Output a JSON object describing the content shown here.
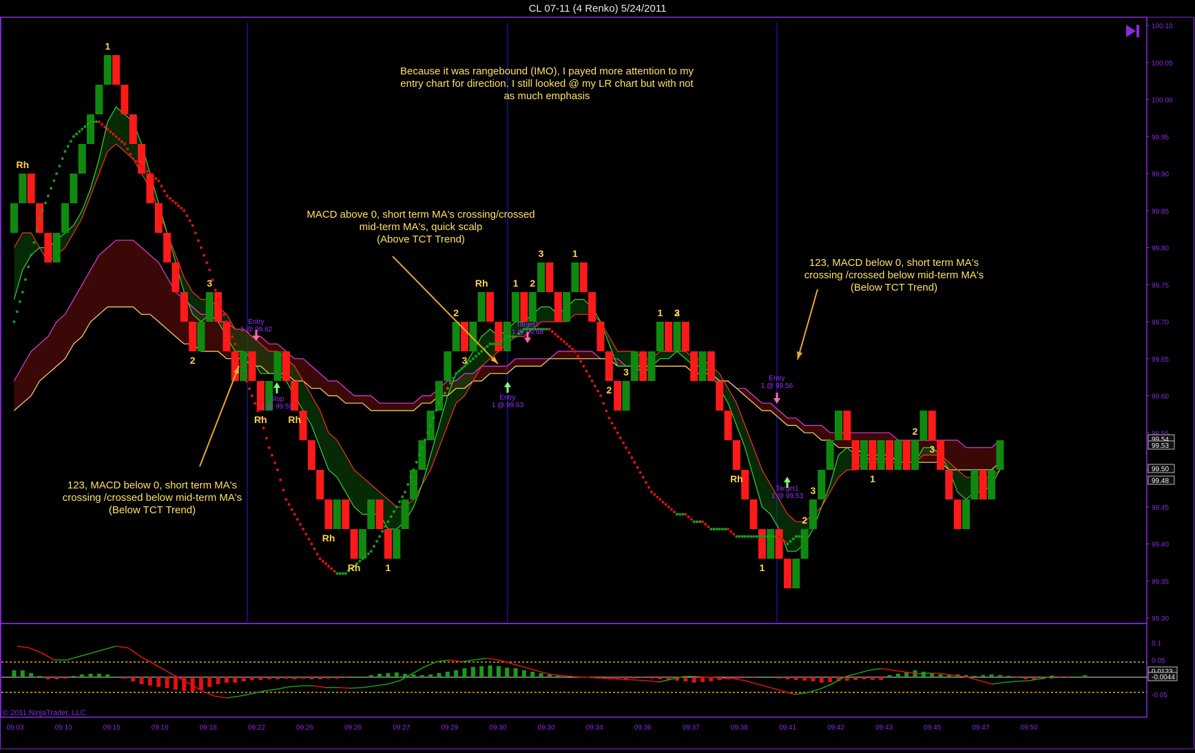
{
  "window": {
    "title": "CL 07-11 (4 Renko)  5/24/2011"
  },
  "copyright": "© 2011 NinjaTrader, LLC",
  "colors": {
    "background": "#000000",
    "frame": "#8a2be2",
    "axis_text": "#8a2be2",
    "bull_bar": "#0f8a0f",
    "bear_bar": "#ff1a1a",
    "annotation_text": "#ffe066",
    "pattern_label": "#ffd34d",
    "session_line": "#1c1cbf"
  },
  "chart_data": [
    {
      "type": "renko",
      "panel": "price",
      "instrument": "CL 07-11",
      "brick_size": "4 Renko",
      "date": "5/24/2011",
      "ylim": [
        99.3,
        100.1
      ],
      "y_ticks": [
        "100.10",
        "100.05",
        "100.00",
        "99.95",
        "99.90",
        "99.85",
        "99.80",
        "99.75",
        "99.70",
        "99.65",
        "99.60",
        "99.55",
        "99.50",
        "99.45",
        "99.40",
        "99.35",
        "99.30"
      ],
      "x_ticks": [
        "09:03",
        "09:10",
        "09:15",
        "09:16",
        "09:18",
        "09:22",
        "09:26",
        "09:26",
        "09:27",
        "09:29",
        "09:30",
        "09:30",
        "09:34",
        "09:36",
        "09:37",
        "09:38",
        "09:41",
        "09:42",
        "09:43",
        "09:45",
        "09:47",
        "09:50"
      ],
      "brick_closes": [
        99.86,
        99.9,
        99.86,
        99.82,
        99.78,
        99.82,
        99.86,
        99.9,
        99.94,
        99.98,
        100.02,
        100.06,
        100.02,
        99.98,
        99.94,
        99.9,
        99.86,
        99.82,
        99.78,
        99.74,
        99.7,
        99.66,
        99.7,
        99.74,
        99.7,
        99.66,
        99.62,
        99.66,
        99.62,
        99.58,
        99.62,
        99.66,
        99.62,
        99.58,
        99.54,
        99.5,
        99.46,
        99.42,
        99.46,
        99.42,
        99.38,
        99.42,
        99.46,
        99.42,
        99.38,
        99.42,
        99.46,
        99.5,
        99.54,
        99.58,
        99.62,
        99.66,
        99.7,
        99.66,
        99.7,
        99.74,
        99.7,
        99.66,
        99.7,
        99.74,
        99.7,
        99.74,
        99.78,
        99.74,
        99.7,
        99.74,
        99.78,
        99.74,
        99.7,
        99.66,
        99.62,
        99.58,
        99.62,
        99.66,
        99.62,
        99.66,
        99.7,
        99.66,
        99.7,
        99.66,
        99.62,
        99.66,
        99.62,
        99.58,
        99.54,
        99.5,
        99.46,
        99.42,
        99.38,
        99.42,
        99.38,
        99.34,
        99.38,
        99.42,
        99.46,
        99.5,
        99.54,
        99.58,
        99.54,
        99.5,
        99.54,
        99.5,
        99.54,
        99.5,
        99.54,
        99.5,
        99.54,
        99.58,
        99.54,
        99.5,
        99.46,
        99.42,
        99.46,
        99.5,
        99.46,
        99.5,
        99.54
      ],
      "current_price_tags": [
        "99.54",
        "99.53",
        "99.50",
        "99.48"
      ],
      "fast_ma": [
        99.73,
        99.77,
        99.79,
        99.8,
        99.8,
        99.81,
        99.82,
        99.83,
        99.85,
        99.88,
        99.92,
        99.97,
        99.99,
        99.98,
        99.97,
        99.94,
        99.9,
        99.86,
        99.82,
        99.78,
        99.74,
        99.71,
        99.7,
        99.71,
        99.7,
        99.68,
        99.66,
        99.66,
        99.65,
        99.63,
        99.63,
        99.63,
        99.62,
        99.6,
        99.58,
        99.56,
        99.53,
        99.5,
        99.49,
        99.47,
        99.45,
        99.44,
        99.44,
        99.44,
        99.42,
        99.42,
        99.43,
        99.45,
        99.48,
        99.52,
        99.56,
        99.6,
        99.63,
        99.64,
        99.66,
        99.68,
        99.69,
        99.68,
        99.69,
        99.7,
        99.7,
        99.71,
        99.72,
        99.72,
        99.71,
        99.72,
        99.73,
        99.73,
        99.72,
        99.7,
        99.67,
        99.64,
        99.64,
        99.64,
        99.63,
        99.64,
        99.65,
        99.65,
        99.66,
        99.65,
        99.64,
        99.64,
        99.63,
        99.61,
        99.59,
        99.56,
        99.53,
        99.49,
        99.45,
        99.44,
        99.42,
        99.39,
        99.39,
        99.4,
        99.42,
        99.45,
        99.48,
        99.52,
        99.53,
        99.52,
        99.52,
        99.51,
        99.52,
        99.51,
        99.51,
        99.51,
        99.51,
        99.53,
        99.53,
        99.52,
        99.5,
        99.47,
        99.46,
        99.47,
        99.47,
        99.48,
        99.5
      ],
      "medium_ma": [
        99.8,
        99.82,
        99.82,
        99.8,
        99.78,
        99.79,
        99.8,
        99.82,
        99.84,
        99.87,
        99.9,
        99.93,
        99.94,
        99.93,
        99.92,
        99.9,
        99.88,
        99.85,
        99.82,
        99.79,
        99.76,
        99.74,
        99.73,
        99.73,
        99.72,
        99.71,
        99.69,
        99.69,
        99.68,
        99.67,
        99.66,
        99.66,
        99.65,
        99.64,
        99.62,
        99.6,
        99.58,
        99.55,
        99.54,
        99.52,
        99.5,
        99.49,
        99.48,
        99.47,
        99.46,
        99.45,
        99.45,
        99.46,
        99.48,
        99.5,
        99.53,
        99.56,
        99.59,
        99.6,
        99.62,
        99.64,
        99.65,
        99.66,
        99.67,
        99.68,
        99.68,
        99.69,
        99.7,
        99.7,
        99.7,
        99.7,
        99.71,
        99.71,
        99.71,
        99.7,
        99.68,
        99.66,
        99.66,
        99.66,
        99.65,
        99.65,
        99.66,
        99.66,
        99.66,
        99.66,
        99.65,
        99.65,
        99.64,
        99.63,
        99.61,
        99.59,
        99.56,
        99.53,
        99.5,
        99.48,
        99.46,
        99.44,
        99.43,
        99.43,
        99.44,
        99.45,
        99.47,
        99.49,
        99.5,
        99.5,
        99.51,
        99.51,
        99.51,
        99.51,
        99.51,
        99.51,
        99.51,
        99.52,
        99.52,
        99.52,
        99.51,
        99.5,
        99.49,
        99.49,
        99.49,
        99.49,
        99.5
      ],
      "slow_ma_1": [
        99.62,
        99.64,
        99.66,
        99.67,
        99.68,
        99.7,
        99.71,
        99.73,
        99.75,
        99.77,
        99.79,
        99.8,
        99.81,
        99.81,
        99.81,
        99.8,
        99.79,
        99.78,
        99.76,
        99.74,
        99.73,
        99.72,
        99.71,
        99.71,
        99.7,
        99.7,
        99.69,
        99.69,
        99.68,
        99.68,
        99.67,
        99.67,
        99.66,
        99.65,
        99.65,
        99.64,
        99.63,
        99.62,
        99.62,
        99.61,
        99.6,
        99.6,
        99.6,
        99.59,
        99.59,
        99.59,
        99.59,
        99.59,
        99.6,
        99.6,
        99.61,
        99.62,
        99.62,
        99.63,
        99.63,
        99.64,
        99.64,
        99.64,
        99.64,
        99.65,
        99.65,
        99.65,
        99.65,
        99.65,
        99.66,
        99.66,
        99.66,
        99.66,
        99.66,
        99.65,
        99.65,
        99.65,
        99.64,
        99.64,
        99.64,
        99.64,
        99.64,
        99.64,
        99.64,
        99.64,
        99.63,
        99.63,
        99.63,
        99.62,
        99.62,
        99.61,
        99.61,
        99.6,
        99.59,
        99.59,
        99.58,
        99.57,
        99.57,
        99.56,
        99.56,
        99.56,
        99.55,
        99.55,
        99.55,
        99.55,
        99.55,
        99.55,
        99.55,
        99.55,
        99.54,
        99.54,
        99.54,
        99.54,
        99.54,
        99.54,
        99.54,
        99.54,
        99.53,
        99.53,
        99.53,
        99.53,
        99.54
      ],
      "slow_ma_2": [
        99.58,
        99.59,
        99.6,
        99.62,
        99.63,
        99.64,
        99.65,
        99.67,
        99.68,
        99.7,
        99.71,
        99.72,
        99.72,
        99.72,
        99.72,
        99.71,
        99.71,
        99.7,
        99.69,
        99.68,
        99.67,
        99.67,
        99.66,
        99.66,
        99.66,
        99.65,
        99.65,
        99.65,
        99.64,
        99.64,
        99.63,
        99.63,
        99.63,
        99.62,
        99.62,
        99.61,
        99.61,
        99.6,
        99.6,
        99.59,
        99.59,
        99.59,
        99.58,
        99.58,
        99.58,
        99.58,
        99.58,
        99.58,
        99.59,
        99.59,
        99.6,
        99.6,
        99.61,
        99.61,
        99.62,
        99.62,
        99.63,
        99.63,
        99.63,
        99.64,
        99.64,
        99.64,
        99.64,
        99.65,
        99.65,
        99.65,
        99.65,
        99.65,
        99.65,
        99.65,
        99.65,
        99.64,
        99.64,
        99.64,
        99.64,
        99.64,
        99.64,
        99.64,
        99.64,
        99.64,
        99.63,
        99.63,
        99.63,
        99.62,
        99.62,
        99.61,
        99.6,
        99.59,
        99.58,
        99.58,
        99.57,
        99.56,
        99.56,
        99.55,
        99.55,
        99.54,
        99.54,
        99.53,
        99.53,
        99.53,
        99.52,
        99.52,
        99.52,
        99.52,
        99.51,
        99.51,
        99.51,
        99.51,
        99.51,
        99.51,
        99.5,
        99.5,
        99.5,
        99.5,
        99.5,
        99.5,
        99.51
      ],
      "long_ma": [
        99.7,
        99.74,
        99.79,
        99.84,
        99.87,
        99.9,
        99.93,
        99.95,
        99.96,
        99.97,
        99.97,
        99.96,
        99.95,
        99.94,
        99.92,
        99.91,
        99.9,
        99.89,
        99.87,
        99.86,
        99.85,
        99.83,
        99.8,
        99.77,
        99.73,
        99.7,
        99.67,
        99.63,
        99.6,
        99.57,
        99.53,
        99.5,
        99.46,
        99.44,
        99.42,
        99.4,
        99.38,
        99.37,
        99.36,
        99.36,
        99.37,
        99.38,
        99.39,
        99.41,
        99.43,
        99.45,
        99.47,
        99.5,
        99.53,
        99.56,
        99.59,
        99.61,
        99.63,
        99.64,
        99.65,
        99.66,
        99.67,
        99.67,
        99.68,
        99.68,
        99.69,
        99.69,
        99.69,
        99.69,
        99.68,
        99.67,
        99.66,
        99.64,
        99.62,
        99.6,
        99.57,
        99.55,
        99.53,
        99.51,
        99.49,
        99.47,
        99.46,
        99.45,
        99.44,
        99.44,
        99.43,
        99.43,
        99.42,
        99.42,
        99.42,
        99.41,
        99.41,
        99.41,
        99.41,
        99.41,
        99.41,
        99.4,
        99.41,
        99.41
      ],
      "annotations": [
        {
          "text": "Because it was rangebound (IMO), I payed more attention to my\nentry chart for direction.  I still looked @ my LR chart but with not\nas much emphasis"
        },
        {
          "text": "MACD above 0, short term MA's crossing/crossed\nmid-term MA's, quick scalp\n(Above TCT Trend)"
        },
        {
          "text": "123, MACD below 0, short term MA's\ncrossing /crossed below mid-term MA's\n(Below TCT Trend)"
        },
        {
          "text": "123, MACD below 0, short term MA's\ncrossing /crossed below mid-term MA's\n(Below TCT Trend)"
        }
      ],
      "pattern_labels": [
        {
          "text": "1",
          "brick": 11
        },
        {
          "text": "Rh",
          "brick": 1
        },
        {
          "text": "3",
          "brick": 23
        },
        {
          "text": "2",
          "brick": 21
        },
        {
          "text": "Rh",
          "brick": 29
        },
        {
          "text": "Rh",
          "brick": 33
        },
        {
          "text": "Rh",
          "brick": 37
        },
        {
          "text": "Rh",
          "brick": 40
        },
        {
          "text": "1",
          "brick": 44
        },
        {
          "text": "2",
          "brick": 52
        },
        {
          "text": "3",
          "brick": 53
        },
        {
          "text": "Rh",
          "brick": 55
        },
        {
          "text": "1",
          "brick": 59
        },
        {
          "text": "3",
          "brick": 62
        },
        {
          "text": "1",
          "brick": 66
        },
        {
          "text": "2",
          "brick": 61
        },
        {
          "text": "2",
          "brick": 70
        },
        {
          "text": "3",
          "brick": 72
        },
        {
          "text": "1",
          "brick": 76
        },
        {
          "text": "3",
          "brick": 78
        },
        {
          "text": "2",
          "brick": 78
        },
        {
          "text": "Rh",
          "brick": 85
        },
        {
          "text": "1",
          "brick": 88
        },
        {
          "text": "2",
          "brick": 93
        },
        {
          "text": "3",
          "brick": 94
        },
        {
          "text": "1",
          "brick": 101
        },
        {
          "text": "3",
          "brick": 108
        },
        {
          "text": "2",
          "brick": 106
        }
      ],
      "trade_markers": [
        {
          "label": "Entry",
          "price": "1 @ 99.62"
        },
        {
          "label": "Stop",
          "price": "1 @ 99.59"
        },
        {
          "label": "Entry",
          "price": "1 @ 99.63"
        },
        {
          "label": "Target1",
          "price": "1 @ 99.68"
        },
        {
          "label": "Entry",
          "price": "1 @ 99.56"
        },
        {
          "label": "Target1",
          "price": "1 @ 99.53"
        }
      ]
    },
    {
      "type": "bar",
      "panel": "macd",
      "ylim": [
        -0.07,
        0.1
      ],
      "y_ticks": [
        "0.1",
        "0.05",
        "-0.05"
      ],
      "current_value_tags": [
        "0.0123",
        "-0.0044"
      ],
      "reference_levels": [
        0.044,
        0,
        -0.044
      ],
      "histogram": [
        0.02,
        0.02,
        0.012,
        0.004,
        -0.006,
        -0.006,
        -0.004,
        0.004,
        0.008,
        0.01,
        0.01,
        0.008,
        0.002,
        -0.004,
        -0.012,
        -0.02,
        -0.024,
        -0.028,
        -0.032,
        -0.036,
        -0.04,
        -0.042,
        -0.036,
        -0.028,
        -0.02,
        -0.016,
        -0.016,
        -0.012,
        -0.008,
        -0.008,
        -0.006,
        -0.006,
        -0.004,
        -0.006,
        -0.004,
        -0.006,
        -0.006,
        -0.004,
        -0.004,
        -0.002,
        0,
        0.002,
        0.006,
        0.01,
        0.012,
        0.014,
        0.01,
        0.008,
        0.006,
        0.008,
        0.012,
        0.016,
        0.02,
        0.026,
        0.03,
        0.032,
        0.034,
        0.032,
        0.028,
        0.026,
        0.02,
        0.016,
        0.012,
        0.008,
        0.006,
        0.004,
        0.002,
        0.002,
        0.002,
        -0.004,
        -0.006,
        -0.006,
        -0.006,
        -0.004,
        -0.002,
        -0.004,
        -0.006,
        -0.008,
        -0.01,
        -0.012,
        -0.016,
        -0.014,
        -0.012,
        -0.008,
        -0.006,
        -0.004,
        -0.002,
        -0.002,
        0,
        0.002,
        -0.004,
        -0.006,
        -0.008,
        -0.01,
        -0.012,
        -0.016,
        -0.014,
        -0.012,
        -0.01,
        -0.008,
        -0.006,
        -0.008,
        -0.008,
        0.006,
        0.01,
        0.016,
        0.02,
        0.016,
        0.012,
        0.008,
        0.006,
        0.008,
        0.006,
        0.004,
        0.006,
        0.008,
        0.006,
        0.004,
        -0.002,
        -0.006,
        -0.008,
        -0.006,
        -0.004,
        -0.002,
        -0.002,
        0.002,
        0.006
      ],
      "macd_line": [
        0.09,
        0.085,
        0.07,
        0.05,
        0.05,
        0.06,
        0.07,
        0.08,
        0.09,
        0.085,
        0.06,
        0.04,
        0.02,
        0,
        -0.02,
        -0.04,
        -0.055,
        -0.06,
        -0.055,
        -0.048,
        -0.04,
        -0.035,
        -0.028,
        -0.025,
        -0.025,
        -0.03,
        -0.03,
        -0.032,
        -0.03,
        -0.025,
        -0.02,
        -0.01,
        0.01,
        0.03,
        0.045,
        0.05,
        0.045,
        0.05,
        0.055,
        0.05,
        0.04,
        0.03,
        0.02,
        0.01,
        0.005,
        0.002,
        0,
        -0.002,
        -0.004,
        -0.006,
        -0.008,
        -0.01,
        -0.014,
        -0.006,
        0.002,
        0.002,
        0,
        -0.002,
        -0.004,
        -0.01,
        -0.02,
        -0.03,
        -0.04,
        -0.05,
        -0.045,
        -0.035,
        -0.02,
        0,
        0.01,
        0.02,
        0.025,
        0.02,
        0.015,
        0.01,
        0.012,
        0.01,
        0.005,
        0,
        -0.01,
        -0.02,
        -0.015,
        -0.012,
        -0.01,
        -0.004,
        0.004
      ]
    }
  ]
}
